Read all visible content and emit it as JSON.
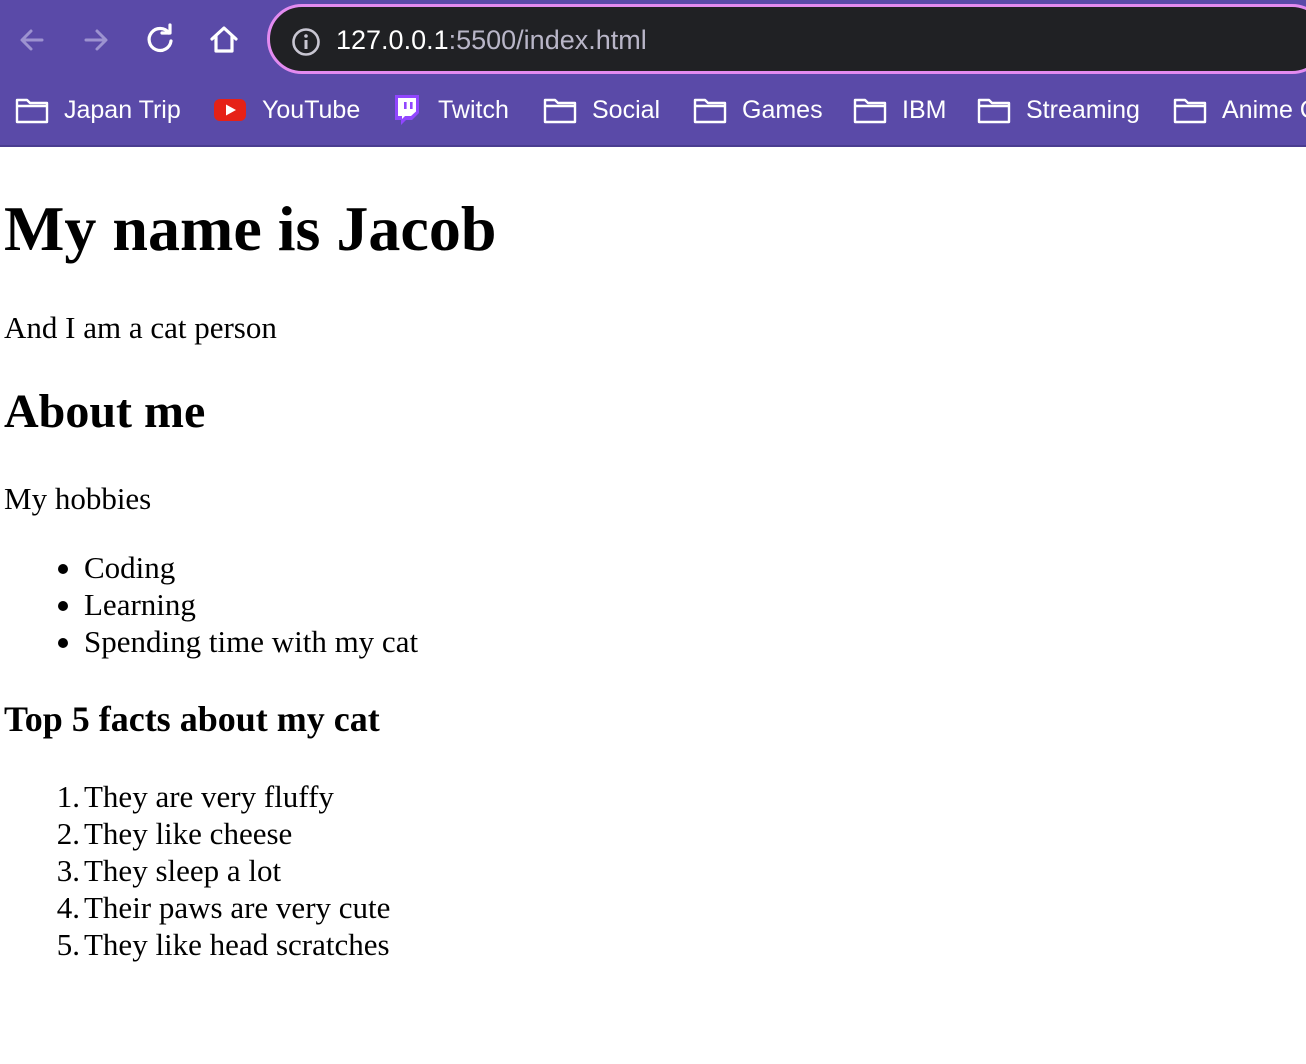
{
  "browser": {
    "url_host": "127.0.0.1",
    "url_rest": ":5500/index.html",
    "bookmarks": [
      {
        "label": "Japan Trip",
        "icon": "folder-icon"
      },
      {
        "label": "YouTube",
        "icon": "youtube-icon"
      },
      {
        "label": "Twitch",
        "icon": "twitch-icon"
      },
      {
        "label": "Social",
        "icon": "folder-icon"
      },
      {
        "label": "Games",
        "icon": "folder-icon"
      },
      {
        "label": "IBM",
        "icon": "folder-icon"
      },
      {
        "label": "Streaming",
        "icon": "folder-icon"
      },
      {
        "label": "Anime C",
        "icon": "folder-icon"
      }
    ],
    "colors": {
      "toolbar": "#5a4aa8",
      "url_border": "#e38bf0",
      "url_bg": "#202124",
      "youtube": "#e62117",
      "twitch": "#9146ff"
    }
  },
  "page": {
    "heading": "My name is Jacob",
    "tagline": "And I am a cat person",
    "about_heading": "About me",
    "hobbies_intro": "My hobbies",
    "hobbies": [
      "Coding",
      "Learning",
      "Spending time with my cat"
    ],
    "facts_heading": "Top 5 facts about my cat",
    "facts": [
      {
        "num": "1.",
        "text": "They are very fluffy"
      },
      {
        "num": "2.",
        "text": "They like cheese"
      },
      {
        "num": "3.",
        "text": "They sleep a lot"
      },
      {
        "num": "4.",
        "text": "Their paws are very cute"
      },
      {
        "num": "5.",
        "text": "They like head scratches"
      }
    ]
  }
}
